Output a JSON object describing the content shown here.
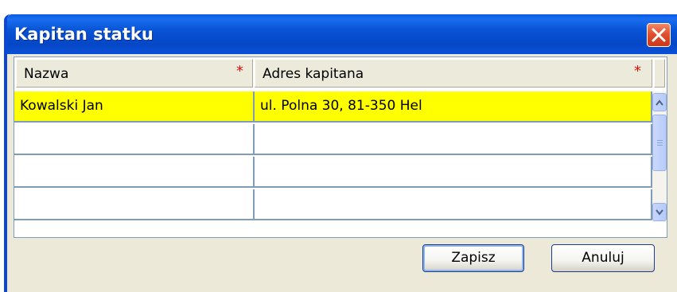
{
  "window": {
    "title": "Kapitan statku"
  },
  "grid": {
    "columns": [
      {
        "label": "Nazwa",
        "required_mark": "*"
      },
      {
        "label": "Adres kapitana",
        "required_mark": "*"
      }
    ],
    "rows": [
      {
        "nazwa": "Kowalski Jan",
        "adres": "ul. Polna 30, 81-350 Hel"
      },
      {
        "nazwa": "",
        "adres": ""
      },
      {
        "nazwa": "",
        "adres": ""
      },
      {
        "nazwa": "",
        "adres": ""
      }
    ],
    "selected_row_color": "#ffff00"
  },
  "buttons": {
    "save_label": "Zapisz",
    "cancel_label": "Anuluj"
  },
  "colors": {
    "titlebar": "#0853d6",
    "window_bg": "#ece9d8",
    "close_button": "#e0512e"
  }
}
